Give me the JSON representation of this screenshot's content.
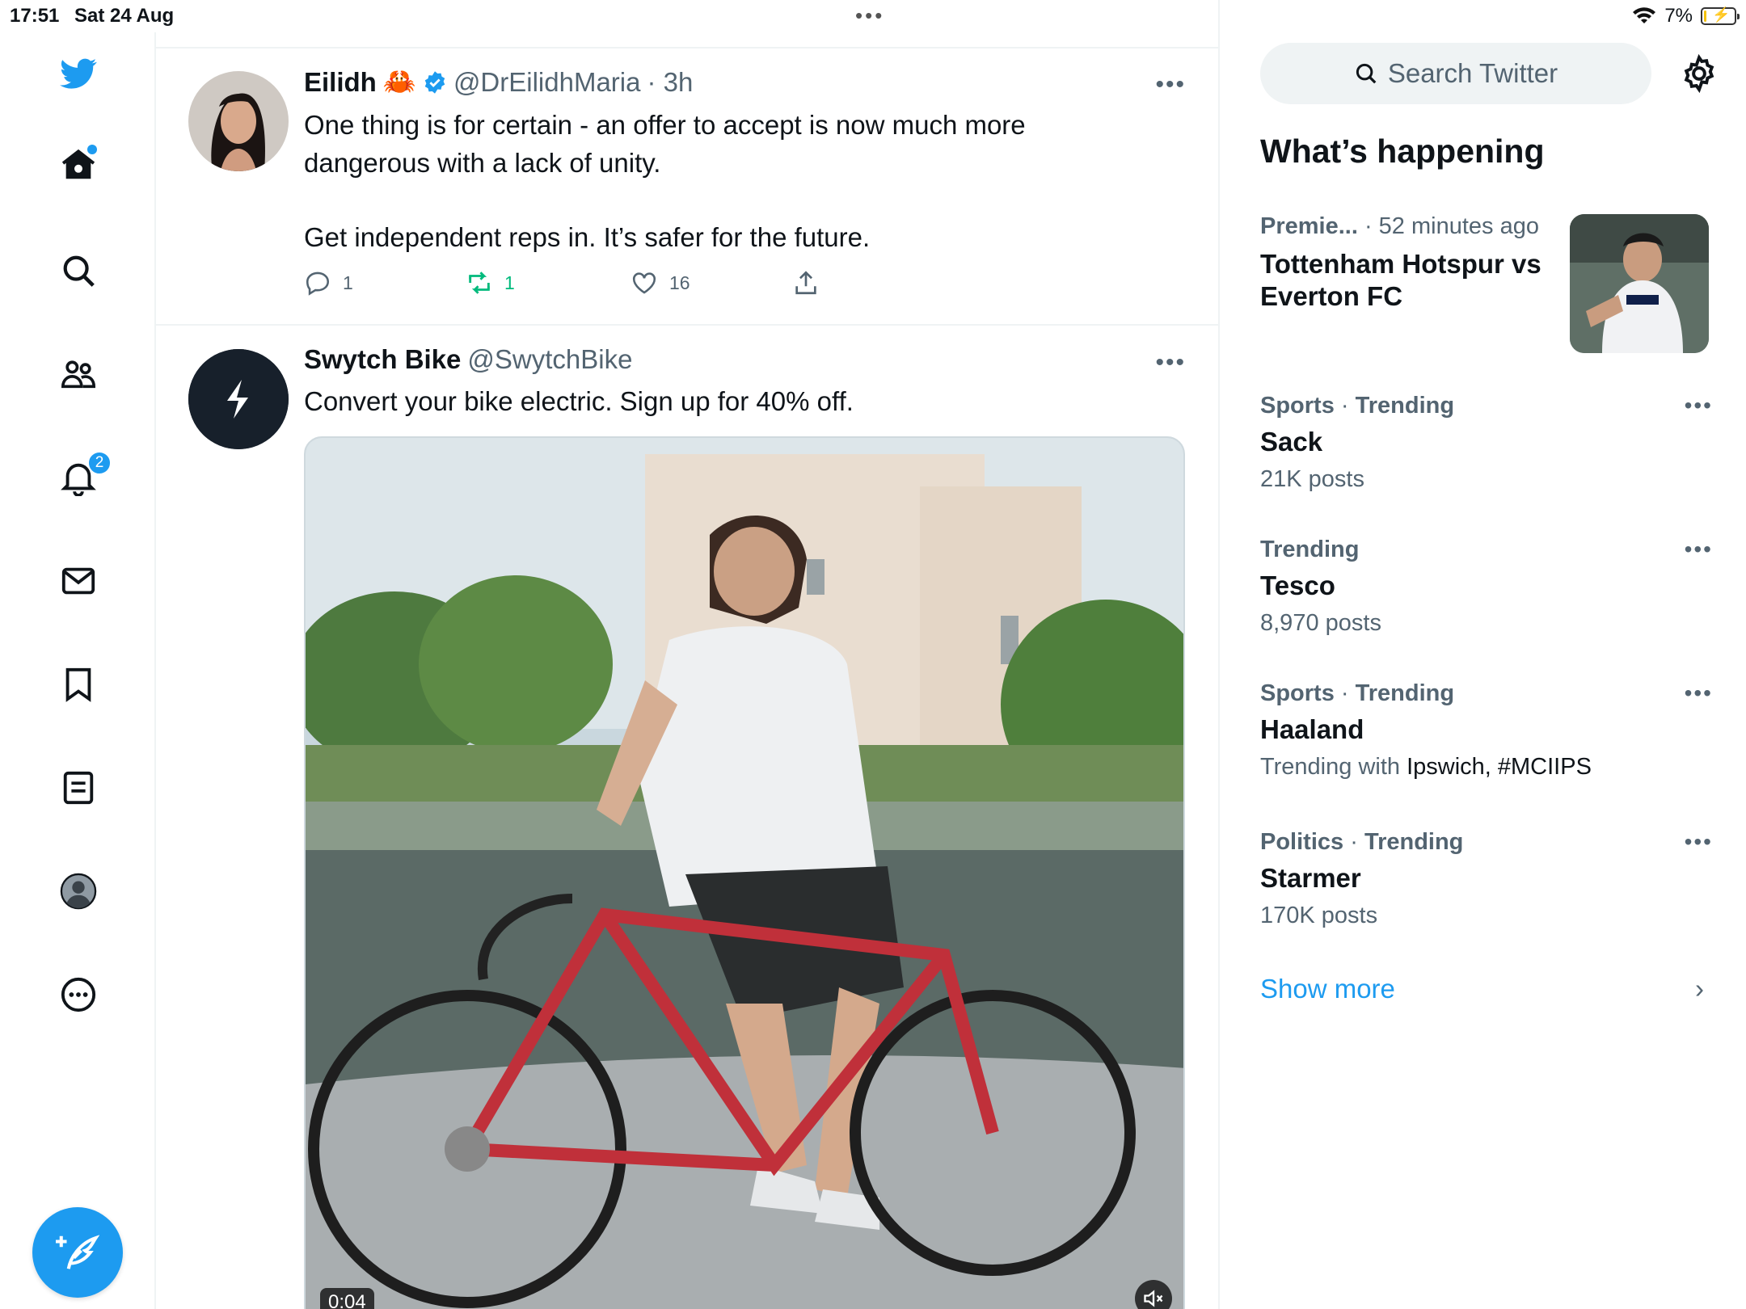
{
  "status_bar": {
    "time": "17:51",
    "date": "Sat 24 Aug",
    "battery": "7%",
    "battery_level": 0.07
  },
  "nav": {
    "home_has_new": true,
    "notifications_badge": "2"
  },
  "feed": {
    "tweets": [
      {
        "name": "Eilidh",
        "emoji": "🦀",
        "verified": true,
        "handle": "@DrEilidhMaria",
        "time": "· 3h",
        "text_line1": "One thing is for certain - an offer to accept is now much more",
        "text_line2": "dangerous with a lack of unity.",
        "text_line3": "Get independent reps in. It’s safer for the future.",
        "replies": "1",
        "retweets": "1",
        "likes": "16"
      },
      {
        "name": "Swytch Bike",
        "handle": "@SwytchBike",
        "text": "Convert your bike electric. Sign up for 40% off.",
        "video_time": "0:04"
      }
    ]
  },
  "sidebar": {
    "search_placeholder": "Search Twitter",
    "whats_happening": "What’s happening",
    "featured": {
      "meta_category": "Premie...",
      "meta_time": "· 52 minutes ago",
      "title_line1": "Tottenham Hotspur vs",
      "title_line2": "Everton FC"
    },
    "trends": [
      {
        "category": "Sports",
        "sep": "·",
        "trending": "Trending",
        "title": "Sack",
        "sub": "21K posts"
      },
      {
        "category": "",
        "sep": "",
        "trending": "Trending",
        "title": "Tesco",
        "sub": "8,970 posts"
      },
      {
        "category": "Sports",
        "sep": "·",
        "trending": "Trending",
        "title": "Haaland",
        "sub_prefix": "Trending with",
        "sub_tags": "Ipswich, #MCIIPS"
      },
      {
        "category": "Politics",
        "sep": "·",
        "trending": "Trending",
        "title": "Starmer",
        "sub": "170K posts"
      }
    ],
    "show_more": "Show more"
  },
  "colors": {
    "accent": "#1d9bf0",
    "retweet_green": "#00ba7c",
    "muted": "#536471"
  }
}
